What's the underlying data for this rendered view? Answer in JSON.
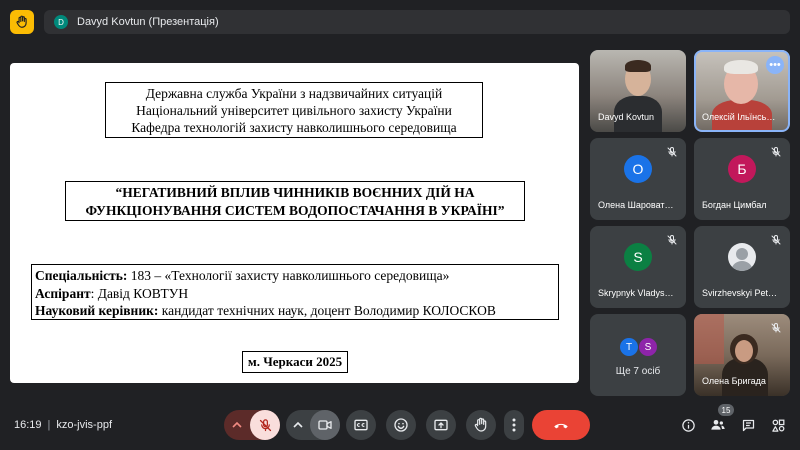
{
  "header": {
    "presenter_initial": "D",
    "presenter_text": "Davyd Kovtun (Презентація)"
  },
  "slide": {
    "org_lines": [
      "Державна служба України з надзвичайних ситуацій",
      "Національний університет цивільного захисту України",
      "Кафедра технологій захисту навколишнього середовища"
    ],
    "title_lines": [
      "“НЕГАТИВНИЙ ВПЛИВ ЧИННИКІВ ВОЄННИХ ДІЙ НА",
      "ФУНКЦІОНУВАННЯ СИСТЕМ ВОДОПОСТАЧАННЯ В УКРАЇНІ”"
    ],
    "specialty_label": "Спеціальність:",
    "specialty_value": " 183 – «Технології захисту навколишнього середовища»",
    "aspirant_label": "Аспірант",
    "aspirant_value": ": Давід КОВТУН",
    "supervisor_label": "Науковий керівник:",
    "supervisor_value": " кандидат технічних наук, доцент Володимир КОЛОСКОВ",
    "city_year": "м. Черкаси 2025"
  },
  "participants": [
    {
      "name": "Davyd Kovtun",
      "type": "video"
    },
    {
      "name": "Олексій Ільїнсь…",
      "type": "video",
      "active": true
    },
    {
      "name": "Олена Шароват…",
      "initial": "О",
      "color": "#1a73e8",
      "muted": true
    },
    {
      "name": "Богдан Цимбал",
      "initial": "Б",
      "color": "#c2185b",
      "muted": true
    },
    {
      "name": "Skrypnyk Vladys…",
      "initial": "S",
      "color": "#0b8043",
      "muted": true
    },
    {
      "name": "Svirzhevskyi Pet…",
      "type": "photo",
      "muted": true
    },
    {
      "name": "Ще 7 осіб",
      "mini": [
        {
          "initial": "T",
          "color": "#1a73e8"
        },
        {
          "initial": "S",
          "color": "#8e24aa"
        }
      ]
    },
    {
      "name": "Олена Бригада",
      "type": "video",
      "muted": true
    }
  ],
  "footer": {
    "time": "16:19",
    "meeting_code": "kzo-jvis-ppf",
    "people_count": "15"
  },
  "colors": {
    "background": "#202124",
    "hand_button": "#fbbc04",
    "end_call": "#ea4335",
    "accent": "#8ab4f8"
  }
}
